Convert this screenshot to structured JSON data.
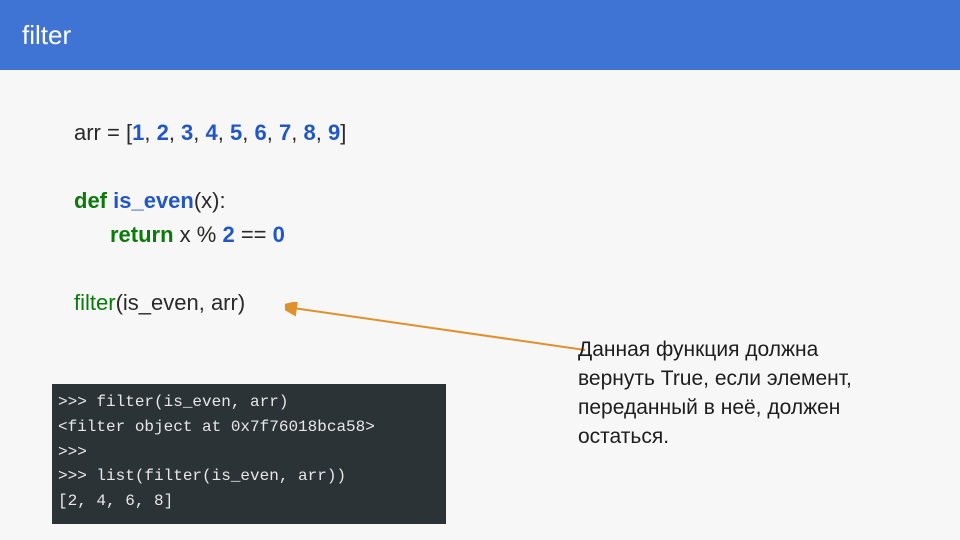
{
  "header": {
    "title": "filter"
  },
  "code": {
    "arr_lhs": "arr",
    "eq": " = [",
    "nums": [
      "1",
      "2",
      "3",
      "4",
      "5",
      "6",
      "7",
      "8",
      "9"
    ],
    "close": "]",
    "def": "def",
    "fname": "is_even",
    "params": "(x):",
    "ret": "return",
    "body_tail": " x % ",
    "two": "2",
    "eqeq": " == ",
    "zero": "0",
    "call_fn": "filter",
    "call_args": "(is_even, arr)"
  },
  "terminal": {
    "l1": ">>> filter(is_even, arr)",
    "l2": "<filter object at 0x7f76018bca58>",
    "l3": ">>>",
    "l4": ">>> list(filter(is_even, arr))",
    "l5": "[2, 4, 6, 8]"
  },
  "note": {
    "text": "Данная функция должна вернуть True, если элемент, переданный в неё, должен остаться."
  },
  "colors": {
    "accent": "#3f74d4",
    "arrow": "#e0912b"
  }
}
